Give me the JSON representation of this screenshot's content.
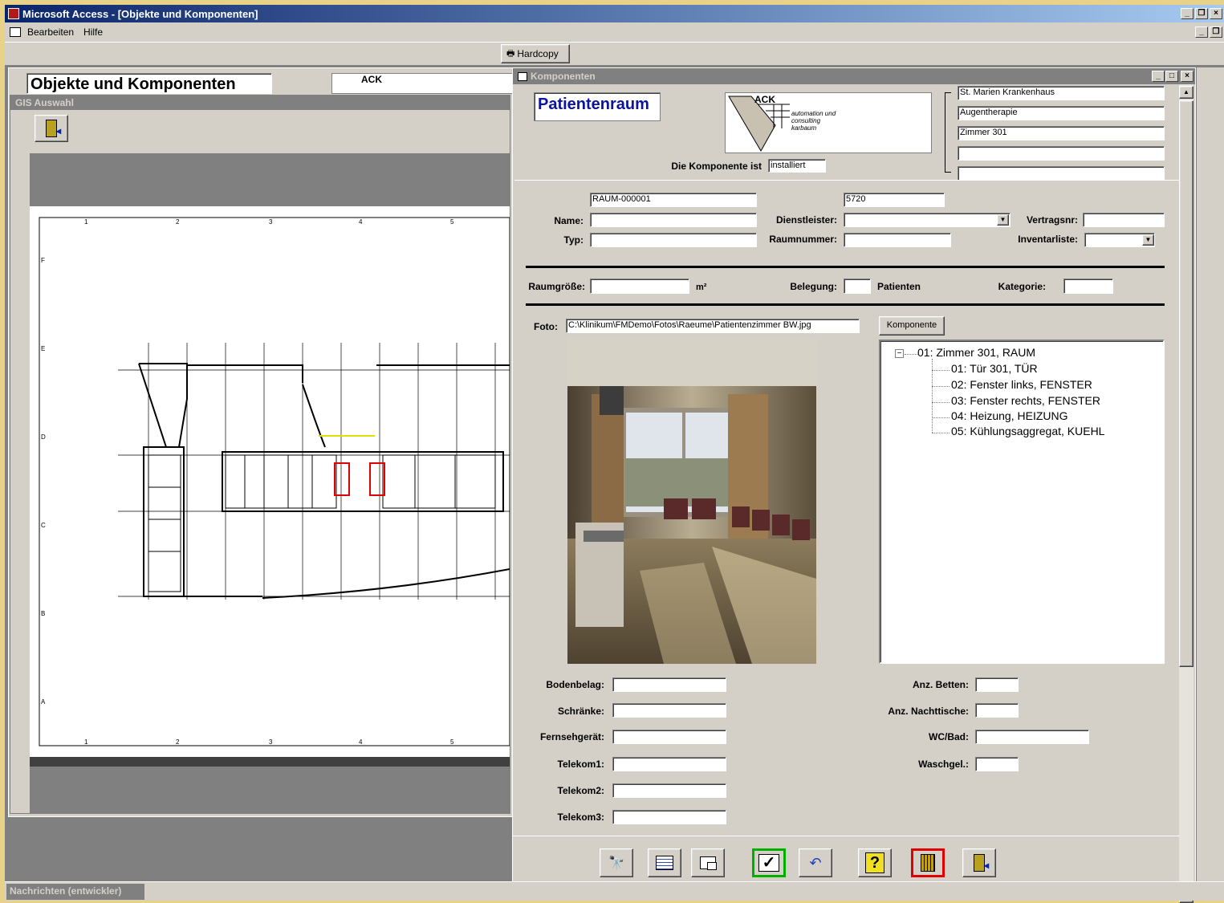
{
  "app": {
    "title": "Microsoft Access - [Objekte und Komponenten]"
  },
  "menu": {
    "items": [
      "Bearbeiten",
      "Hilfe"
    ]
  },
  "toolbar": {
    "hardcopy_label": "Hardcopy"
  },
  "objects_window": {
    "heading": "Objekte und Komponenten",
    "logo_text": "ACK"
  },
  "gis_window": {
    "title": "GIS Auswahl",
    "grid_numbers": [
      "1",
      "2",
      "3",
      "4",
      "5"
    ],
    "grid_letters": [
      "F",
      "E",
      "D",
      "C",
      "B",
      "A"
    ]
  },
  "komponenten": {
    "title": "Komponenten",
    "room_type": "Patientenraum",
    "logo": {
      "brand": "ACK",
      "tagline1": "automation und",
      "tagline2": "consulting",
      "tagline3": "karbaum"
    },
    "hierarchy": [
      "St. Marien Krankenhaus",
      "Augentherapie",
      "Zimmer 301",
      "",
      ""
    ],
    "status_label": "Die Komponente ist",
    "status_value": "installiert",
    "id_value": "RAUM-000001",
    "number_value": "5720",
    "labels": {
      "name": "Name:",
      "typ": "Typ:",
      "dienstleister": "Dienstleister:",
      "raumnummer": "Raumnummer:",
      "vertragsnr": "Vertragsnr:",
      "inventarliste": "Inventarliste:",
      "raumgroesse": "Raumgröße:",
      "unit": "m²",
      "belegung": "Belegung:",
      "patienten": "Patienten",
      "kategorie": "Kategorie:",
      "foto": "Foto:",
      "bodenbelag": "Bodenbelag:",
      "schraenke": "Schränke:",
      "fernseh": "Fernsehgerät:",
      "telekom1": "Telekom1:",
      "telekom2": "Telekom2:",
      "telekom3": "Telekom3:",
      "betten": "Anz. Betten:",
      "nachttische": "Anz. Nachttische:",
      "wcbad": "WC/Bad:",
      "waschgel": "Waschgel.:"
    },
    "foto_path": "C:\\Klinikum\\FMDemo\\Fotos\\Raeume\\Patientenzimmer BW.jpg",
    "komponente_button": "Komponente",
    "tree": {
      "root": "01: Zimmer 301, RAUM",
      "children": [
        "01: Tür 301, TÜR",
        "02: Fenster links, FENSTER",
        "03: Fenster rechts, FENSTER",
        "04: Heizung, HEIZUNG",
        "05: Kühlungsaggregat, KUEHL"
      ]
    }
  },
  "statusbar": {
    "text": "Nachrichten (entwickler)"
  },
  "colors": {
    "title_blue": "#0a246a",
    "room_type": "#0a14a0",
    "ok_green": "#00b000",
    "delete_red": "#e00000"
  }
}
